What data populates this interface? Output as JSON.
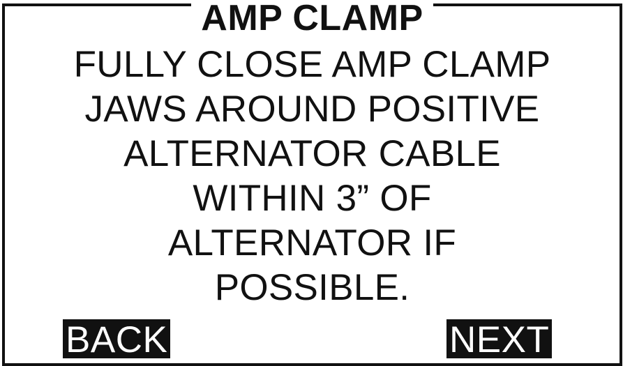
{
  "screen": {
    "title": "AMP CLAMP",
    "instruction_lines": [
      "FULLY CLOSE AMP CLAMP",
      "JAWS AROUND POSITIVE",
      "ALTERNATOR CABLE",
      "WITHIN 3” OF",
      "ALTERNATOR IF",
      "POSSIBLE."
    ]
  },
  "softkeys": {
    "back_label": "BACK",
    "next_label": "NEXT"
  },
  "colors": {
    "foreground": "#111111",
    "background": "#ffffff",
    "softkey_background": "#111111",
    "softkey_text": "#ffffff"
  }
}
